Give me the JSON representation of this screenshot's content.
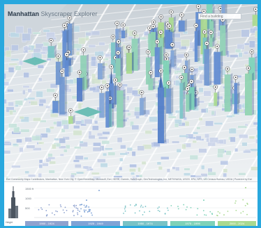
{
  "app": {
    "title_bold": "Manhattan",
    "title_light": "Skyscraper Explorer"
  },
  "search": {
    "placeholder": "Find a building"
  },
  "map": {
    "attribution": "Esri Community Maps Contributors, Manhattan, New York City, © OpenStreetMap, Microsoft, Esri, HERE, Garmin, SafeGraph, GeoTechnologies, Inc, METI/NASA, USGS, EPA, NPS, US Census Bureau, USDA | Powered by Esri",
    "pin_icon": "building-pin-icon"
  },
  "timeline": {
    "y_ticks": [
      "1500 ft",
      "1000",
      "500"
    ],
    "legend_label": "Height",
    "eras": [
      {
        "label": "1900 - 1924",
        "color": "#8fa2cf"
      },
      {
        "label": "1925 - 1949",
        "color": "#7fa3d6"
      },
      {
        "label": "1950 - 1974",
        "color": "#79c3c6"
      },
      {
        "label": "1975 - 1999",
        "color": "#7ed2b8"
      },
      {
        "label": "2000 - 2024",
        "color": "#a9d98f"
      }
    ]
  },
  "colors": {
    "frame": "#29a8de",
    "era1": "#8fa2cf",
    "era2": "#7fa3d6",
    "era3": "#79c3c6",
    "era4": "#7ed2b8",
    "era5": "#a9d98f"
  }
}
